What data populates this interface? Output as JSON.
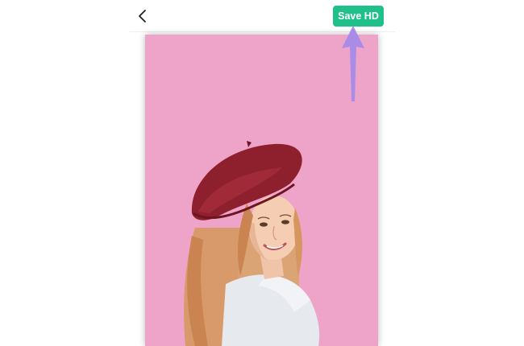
{
  "toolbar": {
    "back_icon": "chevron-left-icon",
    "save_label": "Save HD",
    "save_color": "#1fc08a"
  },
  "canvas": {
    "background_color": "#eea4c9",
    "subject": "cutout-portrait"
  },
  "annotation": {
    "arrow_icon": "arrow-up-icon",
    "arrow_color": "#a98be8"
  }
}
